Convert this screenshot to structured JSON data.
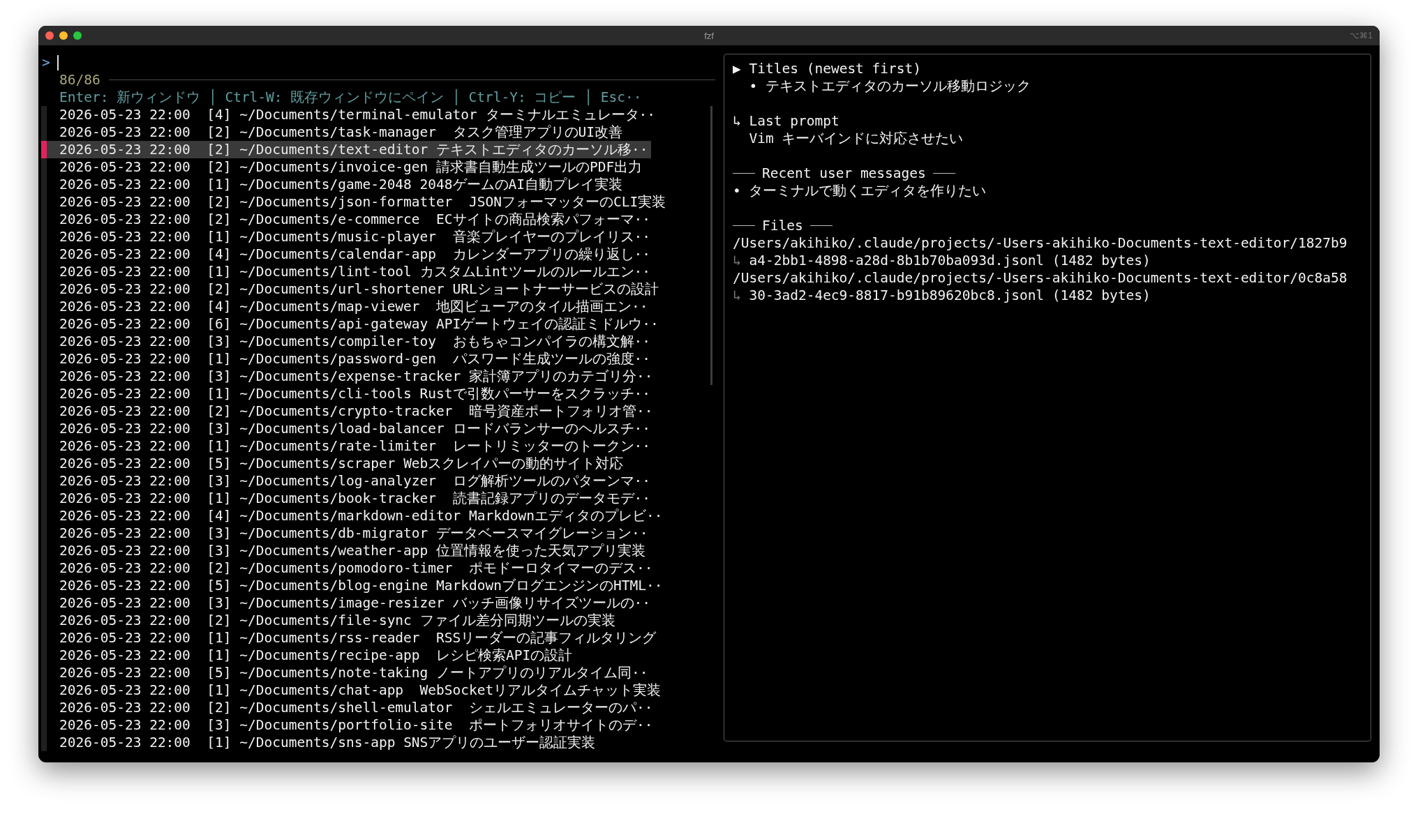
{
  "window": {
    "title": "fzf",
    "shortcut": "⌥⌘1"
  },
  "prompt": {
    "symbol": ">"
  },
  "counter": "86/86",
  "header": "Enter: 新ウィンドウ │ Ctrl-W: 既存ウィンドウにペイン │ Ctrl-Y: コピー │ Esc··",
  "rows": [
    {
      "date": "2026-05-23 22:00",
      "count": "[4]",
      "path": "~/Documents/terminal-emulator",
      "title": "ターミナルエミュレータ··",
      "selected": false
    },
    {
      "date": "2026-05-23 22:00",
      "count": "[2]",
      "path": "~/Documents/task-manager",
      "title": " タスク管理アプリのUI改善",
      "selected": false
    },
    {
      "date": "2026-05-23 22:00",
      "count": "[2]",
      "path": "~/Documents/text-editor",
      "title": "テキストエディタのカーソル移··",
      "selected": true
    },
    {
      "date": "2026-05-23 22:00",
      "count": "[2]",
      "path": "~/Documents/invoice-gen",
      "title": "請求書自動生成ツールのPDF出力",
      "selected": false
    },
    {
      "date": "2026-05-23 22:00",
      "count": "[1]",
      "path": "~/Documents/game-2048",
      "title": "2048ゲームのAI自動プレイ実装",
      "selected": false
    },
    {
      "date": "2026-05-23 22:00",
      "count": "[2]",
      "path": "~/Documents/json-formatter",
      "title": " JSONフォーマッターのCLI実装",
      "selected": false
    },
    {
      "date": "2026-05-23 22:00",
      "count": "[2]",
      "path": "~/Documents/e-commerce",
      "title": " ECサイトの商品検索パフォーマ··",
      "selected": false
    },
    {
      "date": "2026-05-23 22:00",
      "count": "[1]",
      "path": "~/Documents/music-player",
      "title": " 音楽プレイヤーのプレイリス··",
      "selected": false
    },
    {
      "date": "2026-05-23 22:00",
      "count": "[4]",
      "path": "~/Documents/calendar-app",
      "title": " カレンダーアプリの繰り返し··",
      "selected": false
    },
    {
      "date": "2026-05-23 22:00",
      "count": "[1]",
      "path": "~/Documents/lint-tool",
      "title": "カスタムLintツールのルールエン··",
      "selected": false
    },
    {
      "date": "2026-05-23 22:00",
      "count": "[2]",
      "path": "~/Documents/url-shortener",
      "title": "URLショートナーサービスの設計",
      "selected": false
    },
    {
      "date": "2026-05-23 22:00",
      "count": "[4]",
      "path": "~/Documents/map-viewer",
      "title": " 地図ビューアのタイル描画エン··",
      "selected": false
    },
    {
      "date": "2026-05-23 22:00",
      "count": "[6]",
      "path": "~/Documents/api-gateway",
      "title": "APIゲートウェイの認証ミドルウ··",
      "selected": false
    },
    {
      "date": "2026-05-23 22:00",
      "count": "[3]",
      "path": "~/Documents/compiler-toy",
      "title": " おもちゃコンパイラの構文解··",
      "selected": false
    },
    {
      "date": "2026-05-23 22:00",
      "count": "[1]",
      "path": "~/Documents/password-gen",
      "title": " パスワード生成ツールの強度··",
      "selected": false
    },
    {
      "date": "2026-05-23 22:00",
      "count": "[3]",
      "path": "~/Documents/expense-tracker",
      "title": "家計簿アプリのカテゴリ分··",
      "selected": false
    },
    {
      "date": "2026-05-23 22:00",
      "count": "[1]",
      "path": "~/Documents/cli-tools",
      "title": "Rustで引数パーサーをスクラッチ··",
      "selected": false
    },
    {
      "date": "2026-05-23 22:00",
      "count": "[2]",
      "path": "~/Documents/crypto-tracker",
      "title": " 暗号資産ポートフォリオ管··",
      "selected": false
    },
    {
      "date": "2026-05-23 22:00",
      "count": "[3]",
      "path": "~/Documents/load-balancer",
      "title": "ロードバランサーのヘルスチ··",
      "selected": false
    },
    {
      "date": "2026-05-23 22:00",
      "count": "[1]",
      "path": "~/Documents/rate-limiter",
      "title": " レートリミッターのトークン··",
      "selected": false
    },
    {
      "date": "2026-05-23 22:00",
      "count": "[5]",
      "path": "~/Documents/scraper",
      "title": "Webスクレイパーの動的サイト対応",
      "selected": false
    },
    {
      "date": "2026-05-23 22:00",
      "count": "[3]",
      "path": "~/Documents/log-analyzer",
      "title": " ログ解析ツールのパターンマ··",
      "selected": false
    },
    {
      "date": "2026-05-23 22:00",
      "count": "[1]",
      "path": "~/Documents/book-tracker",
      "title": " 読書記録アプリのデータモデ··",
      "selected": false
    },
    {
      "date": "2026-05-23 22:00",
      "count": "[4]",
      "path": "~/Documents/markdown-editor",
      "title": "Markdownエディタのプレビ··",
      "selected": false
    },
    {
      "date": "2026-05-23 22:00",
      "count": "[3]",
      "path": "~/Documents/db-migrator",
      "title": "データベースマイグレーション··",
      "selected": false
    },
    {
      "date": "2026-05-23 22:00",
      "count": "[3]",
      "path": "~/Documents/weather-app",
      "title": "位置情報を使った天気アプリ実装",
      "selected": false
    },
    {
      "date": "2026-05-23 22:00",
      "count": "[2]",
      "path": "~/Documents/pomodoro-timer",
      "title": " ポモドーロタイマーのデス··",
      "selected": false
    },
    {
      "date": "2026-05-23 22:00",
      "count": "[5]",
      "path": "~/Documents/blog-engine",
      "title": "MarkdownブログエンジンのHTML··",
      "selected": false
    },
    {
      "date": "2026-05-23 22:00",
      "count": "[3]",
      "path": "~/Documents/image-resizer",
      "title": "バッチ画像リサイズツールの··",
      "selected": false
    },
    {
      "date": "2026-05-23 22:00",
      "count": "[2]",
      "path": "~/Documents/file-sync",
      "title": "ファイル差分同期ツールの実装",
      "selected": false
    },
    {
      "date": "2026-05-23 22:00",
      "count": "[1]",
      "path": "~/Documents/rss-reader",
      "title": " RSSリーダーの記事フィルタリング",
      "selected": false
    },
    {
      "date": "2026-05-23 22:00",
      "count": "[1]",
      "path": "~/Documents/recipe-app",
      "title": " レシピ検索APIの設計",
      "selected": false
    },
    {
      "date": "2026-05-23 22:00",
      "count": "[5]",
      "path": "~/Documents/note-taking",
      "title": "ノートアプリのリアルタイム同··",
      "selected": false
    },
    {
      "date": "2026-05-23 22:00",
      "count": "[1]",
      "path": "~/Documents/chat-app",
      "title": " WebSocketリアルタイムチャット実装",
      "selected": false
    },
    {
      "date": "2026-05-23 22:00",
      "count": "[2]",
      "path": "~/Documents/shell-emulator",
      "title": " シェルエミュレーターのパ··",
      "selected": false
    },
    {
      "date": "2026-05-23 22:00",
      "count": "[3]",
      "path": "~/Documents/portfolio-site",
      "title": " ポートフォリオサイトのデ··",
      "selected": false
    },
    {
      "date": "2026-05-23 22:00",
      "count": "[1]",
      "path": "~/Documents/sns-app",
      "title": "SNSアプリのユーザー認証実装",
      "selected": false
    }
  ],
  "preview": {
    "sections": [
      {
        "kind": "marker",
        "marker": "▶",
        "title": "Titles (newest first)",
        "lines": [
          {
            "text": "• テキストエディタのカーソル移動ロジック"
          }
        ]
      },
      {
        "kind": "marker",
        "marker": "↳",
        "title": "Last prompt",
        "lines": [
          {
            "text": "Vim キーバインドに対応させたい"
          }
        ]
      },
      {
        "kind": "ruled",
        "title": "Recent user messages",
        "lines": [
          {
            "text": "• ターミナルで動くエディタを作りたい"
          }
        ]
      },
      {
        "kind": "ruled",
        "title": "Files",
        "lines": [
          {
            "text": "/Users/akihiko/.claude/projects/-Users-akihiko-Documents-text-editor/1827b9"
          },
          {
            "wrap": "↳",
            "text": "a4-2bb1-4898-a28d-8b1b70ba093d.jsonl (1482 bytes)"
          },
          {
            "text": "/Users/akihiko/.claude/projects/-Users-akihiko-Documents-text-editor/0c8a58"
          },
          {
            "wrap": "↳",
            "text": "30-3ad2-4ec9-8817-b91b89620bc8.jsonl (1482 bytes)"
          }
        ]
      }
    ]
  }
}
